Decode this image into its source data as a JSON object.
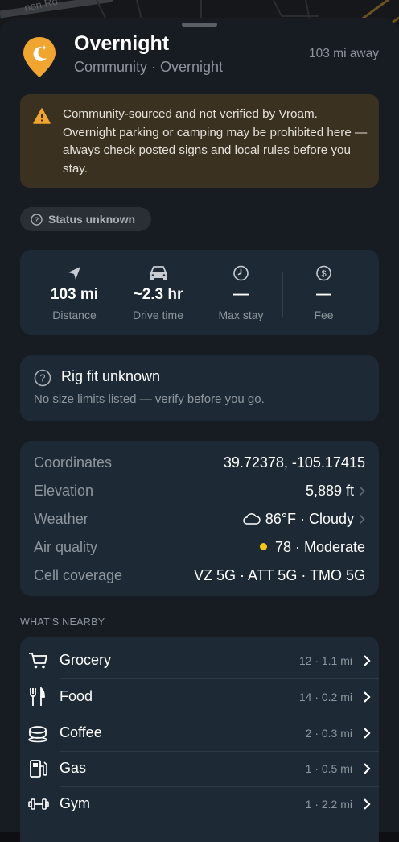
{
  "map": {
    "road_label": "non Rd"
  },
  "place": {
    "title": "Overnight",
    "subtitle": "Community · Overnight",
    "distance_away": "103 mi away",
    "accent_color": "#f0a531"
  },
  "warning": {
    "text": "Community-sourced and not verified by Vroam. Overnight parking or camping may be prohibited here — always check posted signs and local rules before you stay.",
    "icon": "warning-triangle-icon"
  },
  "status": {
    "label": "Status unknown"
  },
  "stats": [
    {
      "icon": "navigation-arrow-icon",
      "value": "103 mi",
      "label": "Distance"
    },
    {
      "icon": "car-icon",
      "value": "~2.3 hr",
      "label": "Drive time"
    },
    {
      "icon": "clock-icon",
      "value": "—",
      "label": "Max stay"
    },
    {
      "icon": "dollar-icon",
      "value": "—",
      "label": "Fee"
    }
  ],
  "rig_fit": {
    "title": "Rig fit unknown",
    "subtitle": "No size limits listed — verify before you go."
  },
  "details": [
    {
      "label": "Coordinates",
      "value": "39.72378, -105.17415"
    },
    {
      "label": "Elevation",
      "value": "5,889 ft"
    },
    {
      "label": "Weather",
      "value": "86°F · Cloudy"
    },
    {
      "label": "Air quality",
      "value": "78 · Moderate",
      "indicator_color": "#f5c518"
    },
    {
      "label": "Cell coverage",
      "value": "VZ 5G · ATT 5G · TMO 5G"
    }
  ],
  "nearby": {
    "heading": "WHAT'S NEARBY",
    "items": [
      {
        "icon": "cart-icon",
        "label": "Grocery",
        "meta": "12 · 1.1 mi"
      },
      {
        "icon": "fork-knife-icon",
        "label": "Food",
        "meta": "14 · 0.2 mi"
      },
      {
        "icon": "coffee-cup-icon",
        "label": "Coffee",
        "meta": "2 · 0.3 mi"
      },
      {
        "icon": "fuel-pump-icon",
        "label": "Gas",
        "meta": "1 · 0.5 mi"
      },
      {
        "icon": "dumbbell-icon",
        "label": "Gym",
        "meta": "1 · 2.2 mi"
      }
    ]
  }
}
